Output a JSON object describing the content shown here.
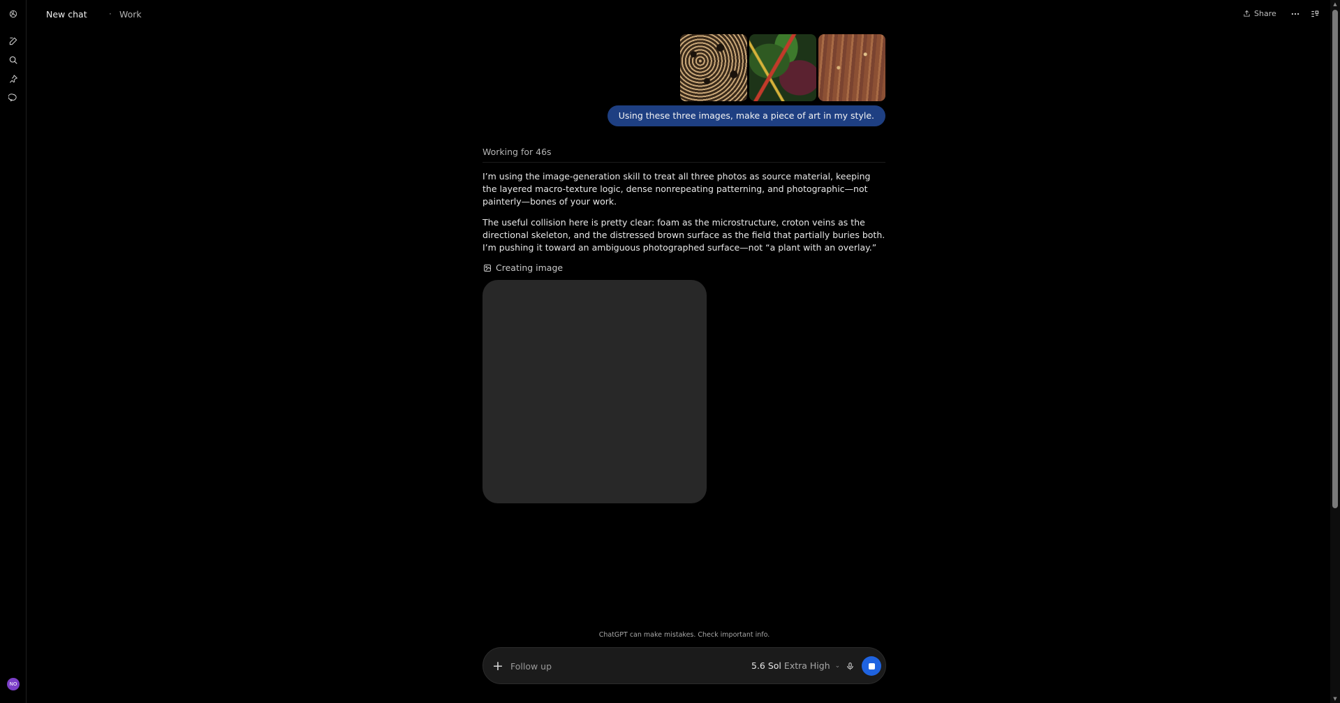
{
  "header": {
    "title": "New chat",
    "separator": "·",
    "project": "Work",
    "share_label": "Share"
  },
  "sidebar": {
    "icons": [
      "openai-logo-icon",
      "new-chat-icon",
      "search-icon",
      "pin-icon",
      "chat-bubble-icon"
    ],
    "avatar_initials": "NO"
  },
  "user_message": {
    "attachments": [
      "foam-texture",
      "croton-leaves",
      "rusty-surface"
    ],
    "text": "Using these three images, make a piece of art in my style."
  },
  "assistant": {
    "status": "Working for 46s",
    "paragraphs": [
      "I’m using the image-generation skill to treat all three photos as source material, keeping the layered macro-texture logic, dense nonrepeating patterning, and photographic—not painterly—bones of your work.",
      "The useful collision here is pretty clear: foam as the microstructure, croton veins as the directional skeleton, and the distressed brown surface as the field that partially buries both. I’m pushing it toward an ambiguous photographed surface—not “a plant with an overlay.”"
    ],
    "creating_label": "Creating image"
  },
  "footer": {
    "disclaimer": "ChatGPT can make mistakes. Check important info.",
    "placeholder": "Follow up",
    "model_name": "5.6 Sol",
    "model_effort": "Extra High"
  },
  "colors": {
    "background": "#000000",
    "user_bubble": "#1e3f82",
    "stop_button": "#1f63e0",
    "avatar": "#7b3fc7",
    "image_placeholder": "#282828"
  }
}
